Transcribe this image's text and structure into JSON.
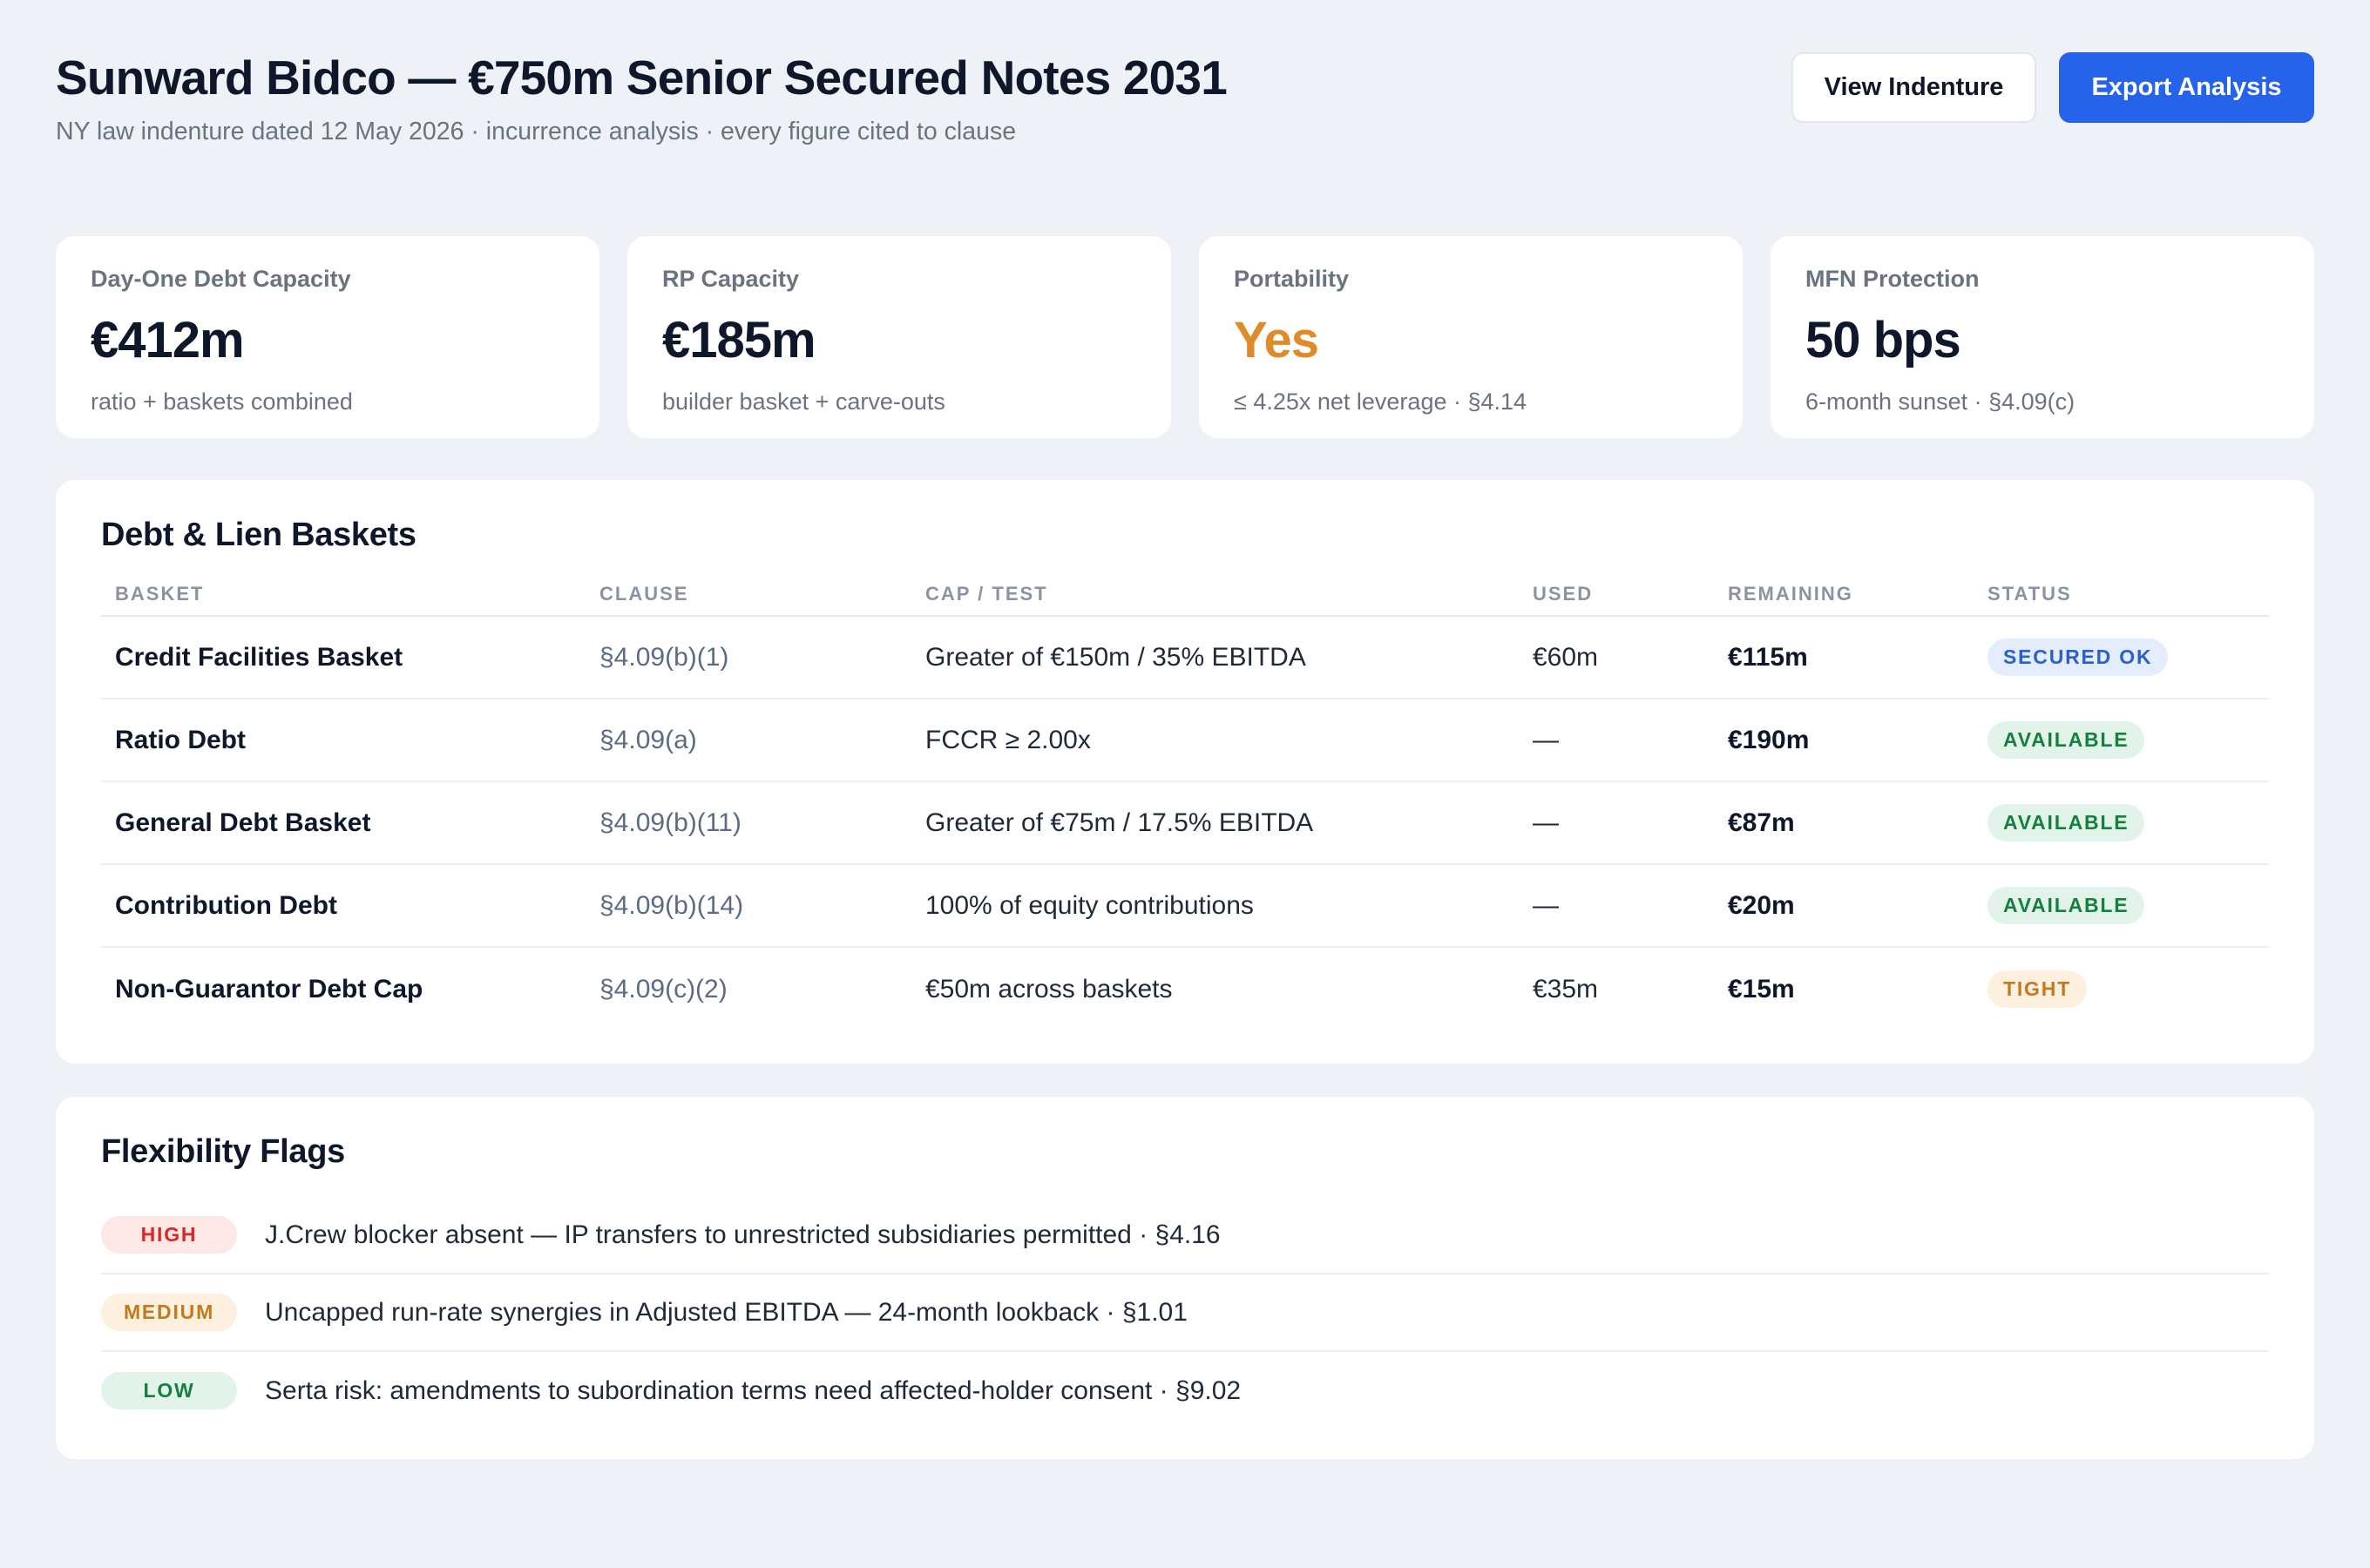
{
  "header": {
    "title": "Sunward Bidco — €750m Senior Secured Notes 2031",
    "subtitle": "NY law indenture dated 12 May 2026 · incurrence analysis · every figure cited to clause",
    "view_button": "View Indenture",
    "export_button": "Export Analysis"
  },
  "kpis": [
    {
      "label": "Day-One Debt Capacity",
      "value": "€412m",
      "note": "ratio + baskets combined"
    },
    {
      "label": "RP Capacity",
      "value": "€185m",
      "note": "builder basket + carve-outs"
    },
    {
      "label": "Portability",
      "value": "Yes",
      "note": "≤ 4.25x net leverage · §4.14",
      "value_color": "#e08a2a"
    },
    {
      "label": "MFN Protection",
      "value": "50 bps",
      "note": "6-month sunset · §4.09(c)"
    }
  ],
  "baskets": {
    "title": "Debt & Lien Baskets",
    "columns": [
      "BASKET",
      "CLAUSE",
      "CAP / TEST",
      "USED",
      "REMAINING",
      "STATUS"
    ],
    "rows": [
      {
        "name": "Credit Facilities Basket",
        "clause": "§4.09(b)(1)",
        "cap": "Greater of €150m / 35% EBITDA",
        "used": "€60m",
        "remaining": "€115m",
        "status": "SECURED OK"
      },
      {
        "name": "Ratio Debt",
        "clause": "§4.09(a)",
        "cap": "FCCR ≥ 2.00x",
        "used": "—",
        "remaining": "€190m",
        "status": "AVAILABLE"
      },
      {
        "name": "General Debt Basket",
        "clause": "§4.09(b)(11)",
        "cap": "Greater of €75m / 17.5% EBITDA",
        "used": "—",
        "remaining": "€87m",
        "status": "AVAILABLE"
      },
      {
        "name": "Contribution Debt",
        "clause": "§4.09(b)(14)",
        "cap": "100% of equity contributions",
        "used": "—",
        "remaining": "€20m",
        "status": "AVAILABLE"
      },
      {
        "name": "Non-Guarantor Debt Cap",
        "clause": "§4.09(c)(2)",
        "cap": "€50m across baskets",
        "used": "€35m",
        "remaining": "€15m",
        "status": "TIGHT"
      }
    ]
  },
  "flags": {
    "title": "Flexibility Flags",
    "items": [
      {
        "level": "HIGH",
        "text": "J.Crew blocker absent — IP transfers to unrestricted subsidiaries permitted · §4.16"
      },
      {
        "level": "MEDIUM",
        "text": "Uncapped run-rate synergies in Adjusted EBITDA — 24-month lookback · §1.01"
      },
      {
        "level": "LOW",
        "text": "Serta risk: amendments to subordination terms need affected-holder consent · §9.02"
      }
    ]
  },
  "colors": {
    "primary": "#2563eb",
    "accent_orange": "#e08a2a",
    "status_blue": "#2a5fcf",
    "status_green": "#15803d",
    "status_amber": "#c27a1e",
    "status_red": "#dc2626"
  }
}
